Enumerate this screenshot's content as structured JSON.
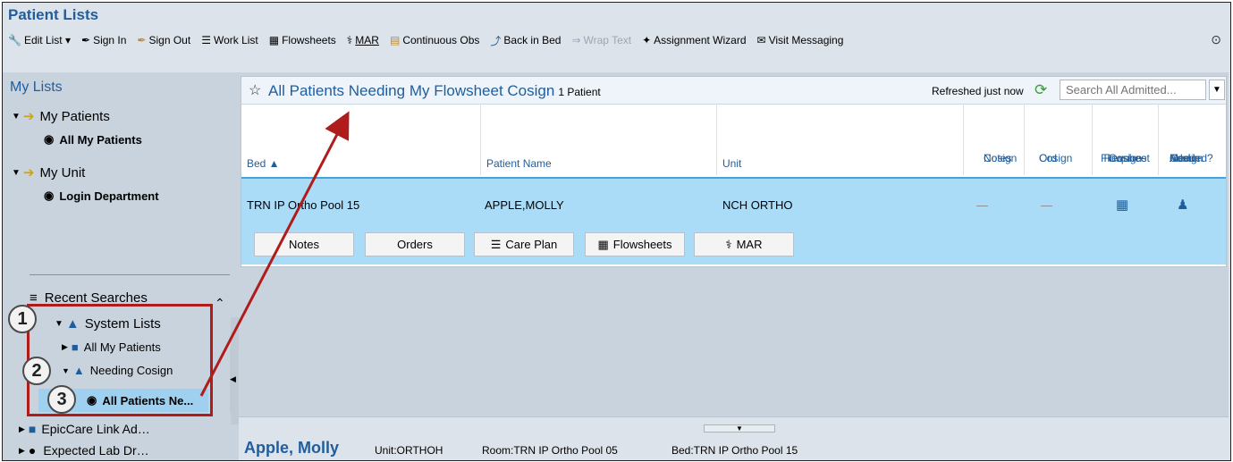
{
  "title": "Patient Lists",
  "toolbar": {
    "items": [
      {
        "label": "Edit List ▾",
        "icon": "🔧"
      },
      {
        "label": "Sign In",
        "icon": "✒"
      },
      {
        "label": "Sign Out",
        "icon": "✒"
      },
      {
        "label": "Work List",
        "icon": "☰"
      },
      {
        "label": "Flowsheets",
        "icon": "▦"
      },
      {
        "label": "MAR",
        "icon": "⚕"
      },
      {
        "label": "Continuous Obs",
        "icon": "▤"
      },
      {
        "label": "Back in Bed",
        "icon": "⤴"
      },
      {
        "label": "Wrap Text",
        "icon": "⇒"
      },
      {
        "label": "Assignment Wizard",
        "icon": "✦"
      },
      {
        "label": "Visit Messaging",
        "icon": "✉"
      }
    ]
  },
  "sidebar": {
    "header": "My Lists",
    "my_patients": "My Patients",
    "all_my_patients": "All My Patients",
    "my_unit": "My Unit",
    "login_department": "Login Department",
    "recent_searches": "Recent Searches",
    "system_lists": "System Lists",
    "sys_all_my_patients": "All My Patients",
    "needing_cosign": "Needing Cosign",
    "all_patients_ne": "All Patients Ne...",
    "epiccare_link": "EpicCare Link Ad…",
    "expected_lab": "Expected Lab Dr…"
  },
  "badges": [
    "1",
    "2",
    "3"
  ],
  "list": {
    "title": "All Patients Needing My Flowsheet Cosign",
    "count": "1 Patient",
    "refreshed": "Refreshed just now",
    "search_placeholder": "Search All Admitted...",
    "columns": {
      "bed": "Bed ▲",
      "patient_name": "Patient Name",
      "unit": "Unit",
      "cosign_notes_1": "Cosign",
      "cosign_notes_2": "Notes",
      "cosign_ord_1": "Cosign",
      "cosign_ord_2": "Ord",
      "flowsheet_1": "Flowsheet",
      "flowsheet_2": "Requires",
      "flowsheet_3": "Cosign",
      "med_1": "Med",
      "med_2": "Admin",
      "med_3": "Cosign",
      "med_4": "Needed?"
    },
    "row": {
      "bed": "TRN IP Ortho Pool 15",
      "patient_name": "APPLE,MOLLY",
      "unit": "NCH ORTHO",
      "cosign_notes": "—",
      "cosign_ord": "—"
    },
    "row_buttons": {
      "notes": "Notes",
      "orders": "Orders",
      "care_plan": "Care Plan",
      "flowsheets": "Flowsheets",
      "mar": "MAR"
    }
  },
  "footer": {
    "patient": "Apple, Molly",
    "unit": "Unit:ORTHOH",
    "room": "Room:TRN IP Ortho Pool 05",
    "bed": "Bed:TRN IP Ortho Pool 15"
  },
  "colors": {
    "accent_blue": "#1f5e9e",
    "selection": "#aadcf8",
    "annotation_red": "#b01c1c"
  }
}
